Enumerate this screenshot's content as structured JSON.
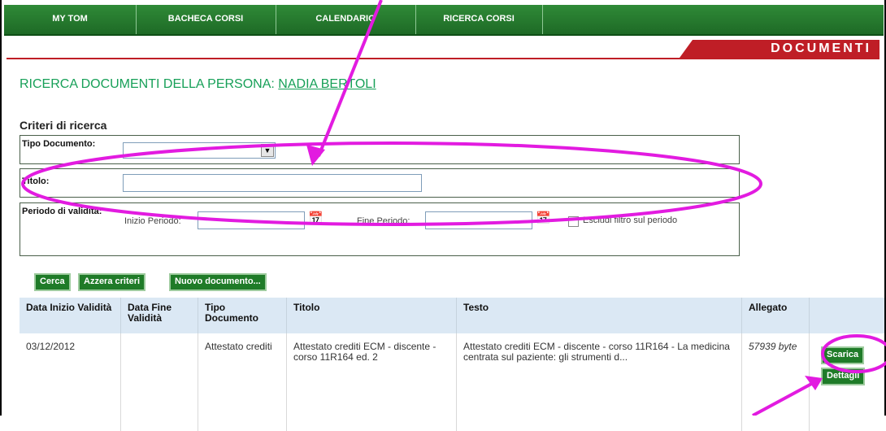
{
  "nav": {
    "items": [
      "MY TOM",
      "BACHECA CORSI",
      "CALENDARIO",
      "RICERCA CORSI"
    ]
  },
  "section": {
    "title": "DOCUMENTI"
  },
  "page": {
    "title_prefix": "RICERCA DOCUMENTI DELLA PERSONA: ",
    "person": "NADIA BERTOLI"
  },
  "criteria": {
    "heading": "Criteri di ricerca",
    "tipo_label": "Tipo Documento:",
    "tipo_value": "",
    "titolo_label": "Titolo:",
    "titolo_value": "",
    "periodo_label": "Periodo di validità:",
    "inizio_label": "Inizio Periodo:",
    "fine_label": "Fine Periodo:",
    "escludi_label": "Escludi filtro sul periodo"
  },
  "buttons": {
    "cerca": "Cerca",
    "azzera": "Azzera criteri",
    "nuovo": "Nuovo documento..."
  },
  "table": {
    "headers": {
      "data_inizio": "Data Inizio Validità",
      "data_fine": "Data Fine Validità",
      "tipo": "Tipo Documento",
      "titolo": "Titolo",
      "testo": "Testo",
      "allegato": "Allegato"
    },
    "rows": [
      {
        "data_inizio": "03/12/2012",
        "data_fine": "",
        "tipo": "Attestato crediti",
        "titolo": "Attestato crediti ECM - discente - corso 11R164 ed. 2",
        "testo": "Attestato crediti ECM - discente - corso 11R164 - La medicina centrata sul paziente: gli strumenti d...",
        "allegato": "57939 byte",
        "scarica": "Scarica",
        "dettagli": "Dettagli"
      }
    ]
  },
  "colors": {
    "nav_green": "#1e6a26",
    "title_green": "#17a058",
    "section_red": "#bf1e26",
    "annotation_magenta": "#e21be0"
  }
}
